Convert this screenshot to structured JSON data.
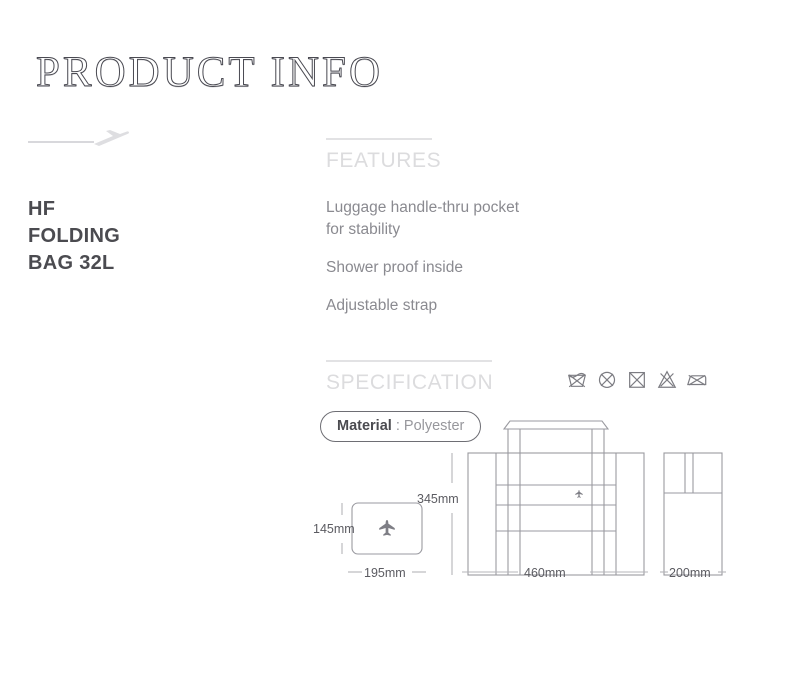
{
  "page": {
    "title": "PRODUCT INFO"
  },
  "brand": {
    "logo_icon": "airplane-takeoff-icon",
    "product_name_lines": [
      "HF",
      "FOLDING",
      "BAG 32L"
    ]
  },
  "features": {
    "heading": "FEATURES",
    "items": [
      "Luggage handle-thru pocket for stability",
      "Shower proof inside",
      "Adjustable strap"
    ]
  },
  "specification": {
    "heading": "SPECIFICATION",
    "material_label": "Material",
    "material_value": ": Polyester",
    "care_symbols": [
      {
        "name": "do-not-wash-icon",
        "label": "Do not wash"
      },
      {
        "name": "do-not-dry-clean-icon",
        "label": "Do not dry clean"
      },
      {
        "name": "do-not-tumble-dry-icon",
        "label": "Do not tumble dry"
      },
      {
        "name": "do-not-bleach-icon",
        "label": "Do not bleach"
      },
      {
        "name": "do-not-iron-icon",
        "label": "Do not iron"
      }
    ],
    "dimensions": {
      "folded_height": "145mm",
      "folded_width": "195mm",
      "bag_height": "345mm",
      "bag_width": "460mm",
      "bag_depth": "200mm"
    },
    "drawing_icons": {
      "folded_bag_logo": "airplane-icon",
      "main_bag_logo": "airplane-icon"
    }
  },
  "colors": {
    "text_dark": "#4b4b50",
    "text_body": "#8a8a90",
    "heading_light": "#dcdcde",
    "rule": "#e2e2e4",
    "line_art": "#8d8d93"
  }
}
